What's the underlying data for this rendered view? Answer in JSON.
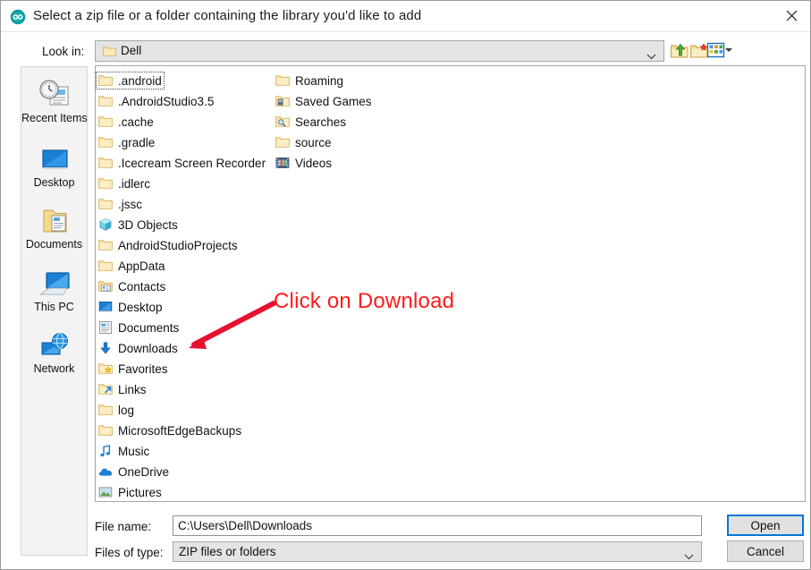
{
  "window": {
    "title": "Select a zip file or a folder containing the library you'd like to add",
    "app_icon": "arduino-logo-icon",
    "close_icon": "close-icon",
    "accent_color": "#0078d7",
    "annotation_color": "#ff1a1a"
  },
  "lookin": {
    "label": "Look in:",
    "value": "Dell",
    "icon": "folder-icon",
    "chevron_icon": "chevron-down-icon"
  },
  "toolbar": {
    "up_one_level": "up-one-level-icon",
    "create_new_folder": "create-new-folder-icon",
    "view_menu": "view-menu-icon",
    "view_menu_arrow": "chevron-down-icon"
  },
  "places": [
    {
      "label": "Recent Items",
      "icon": "recent-items-icon"
    },
    {
      "label": "Desktop",
      "icon": "desktop-icon"
    },
    {
      "label": "Documents",
      "icon": "documents-folder-icon"
    },
    {
      "label": "This PC",
      "icon": "this-pc-icon"
    },
    {
      "label": "Network",
      "icon": "network-icon"
    }
  ],
  "file_list": {
    "columns": [
      [
        {
          "name": ".android",
          "icon": "folder-icon",
          "focused": true
        },
        {
          "name": ".AndroidStudio3.5",
          "icon": "folder-icon",
          "focused": false
        },
        {
          "name": ".cache",
          "icon": "folder-icon",
          "focused": false
        },
        {
          "name": ".gradle",
          "icon": "folder-icon",
          "focused": false
        },
        {
          "name": ".Icecream Screen Recorder",
          "icon": "folder-icon",
          "focused": false
        },
        {
          "name": ".idlerc",
          "icon": "folder-icon",
          "focused": false
        },
        {
          "name": ".jssc",
          "icon": "folder-icon",
          "focused": false
        },
        {
          "name": "3D Objects",
          "icon": "3d-objects-icon",
          "focused": false
        },
        {
          "name": "AndroidStudioProjects",
          "icon": "folder-icon",
          "focused": false
        },
        {
          "name": "AppData",
          "icon": "folder-icon",
          "focused": false
        },
        {
          "name": "Contacts",
          "icon": "contacts-icon",
          "focused": false
        },
        {
          "name": "Desktop",
          "icon": "desktop-icon",
          "focused": false
        },
        {
          "name": "Documents",
          "icon": "documents-icon",
          "focused": false
        },
        {
          "name": "Downloads",
          "icon": "downloads-icon",
          "focused": false
        },
        {
          "name": "Favorites",
          "icon": "favorites-icon",
          "focused": false
        },
        {
          "name": "Links",
          "icon": "links-icon",
          "focused": false
        },
        {
          "name": "log",
          "icon": "folder-icon",
          "focused": false
        },
        {
          "name": "MicrosoftEdgeBackups",
          "icon": "folder-icon",
          "focused": false
        },
        {
          "name": "Music",
          "icon": "music-icon",
          "focused": false
        },
        {
          "name": "OneDrive",
          "icon": "onedrive-icon",
          "focused": false
        },
        {
          "name": "Pictures",
          "icon": "pictures-icon",
          "focused": false
        }
      ],
      [
        {
          "name": "Roaming",
          "icon": "folder-icon",
          "focused": false
        },
        {
          "name": "Saved Games",
          "icon": "saved-games-icon",
          "focused": false
        },
        {
          "name": "Searches",
          "icon": "searches-icon",
          "focused": false
        },
        {
          "name": "source",
          "icon": "folder-icon",
          "focused": false
        },
        {
          "name": "Videos",
          "icon": "videos-icon",
          "focused": false
        }
      ]
    ]
  },
  "annotation": {
    "text": "Click on Download"
  },
  "fields": {
    "filename_label": "File name:",
    "filename_value": "C:\\Users\\Dell\\Downloads",
    "filetype_label": "Files of type:",
    "filetype_value": "ZIP files or folders",
    "chevron_icon": "chevron-down-icon"
  },
  "buttons": {
    "open": "Open",
    "cancel": "Cancel"
  }
}
